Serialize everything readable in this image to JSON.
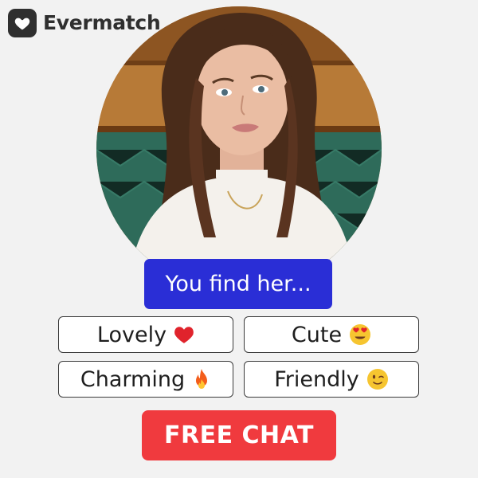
{
  "brand": {
    "name": "Evermatch",
    "icon": "heart-icon"
  },
  "prompt": {
    "text": "You find her..."
  },
  "options": [
    {
      "label": "Lovely",
      "emoji": "red-heart-icon"
    },
    {
      "label": "Cute",
      "emoji": "heart-eyes-face-icon"
    },
    {
      "label": "Charming",
      "emoji": "fire-icon"
    },
    {
      "label": "Friendly",
      "emoji": "winking-face-icon"
    }
  ],
  "cta": {
    "label": "FREE CHAT"
  },
  "colors": {
    "background": "#f2f2f2",
    "logo": "#2f2f2f",
    "prompt_bg": "#2a2ed6",
    "cta_bg": "#f03a3e"
  }
}
